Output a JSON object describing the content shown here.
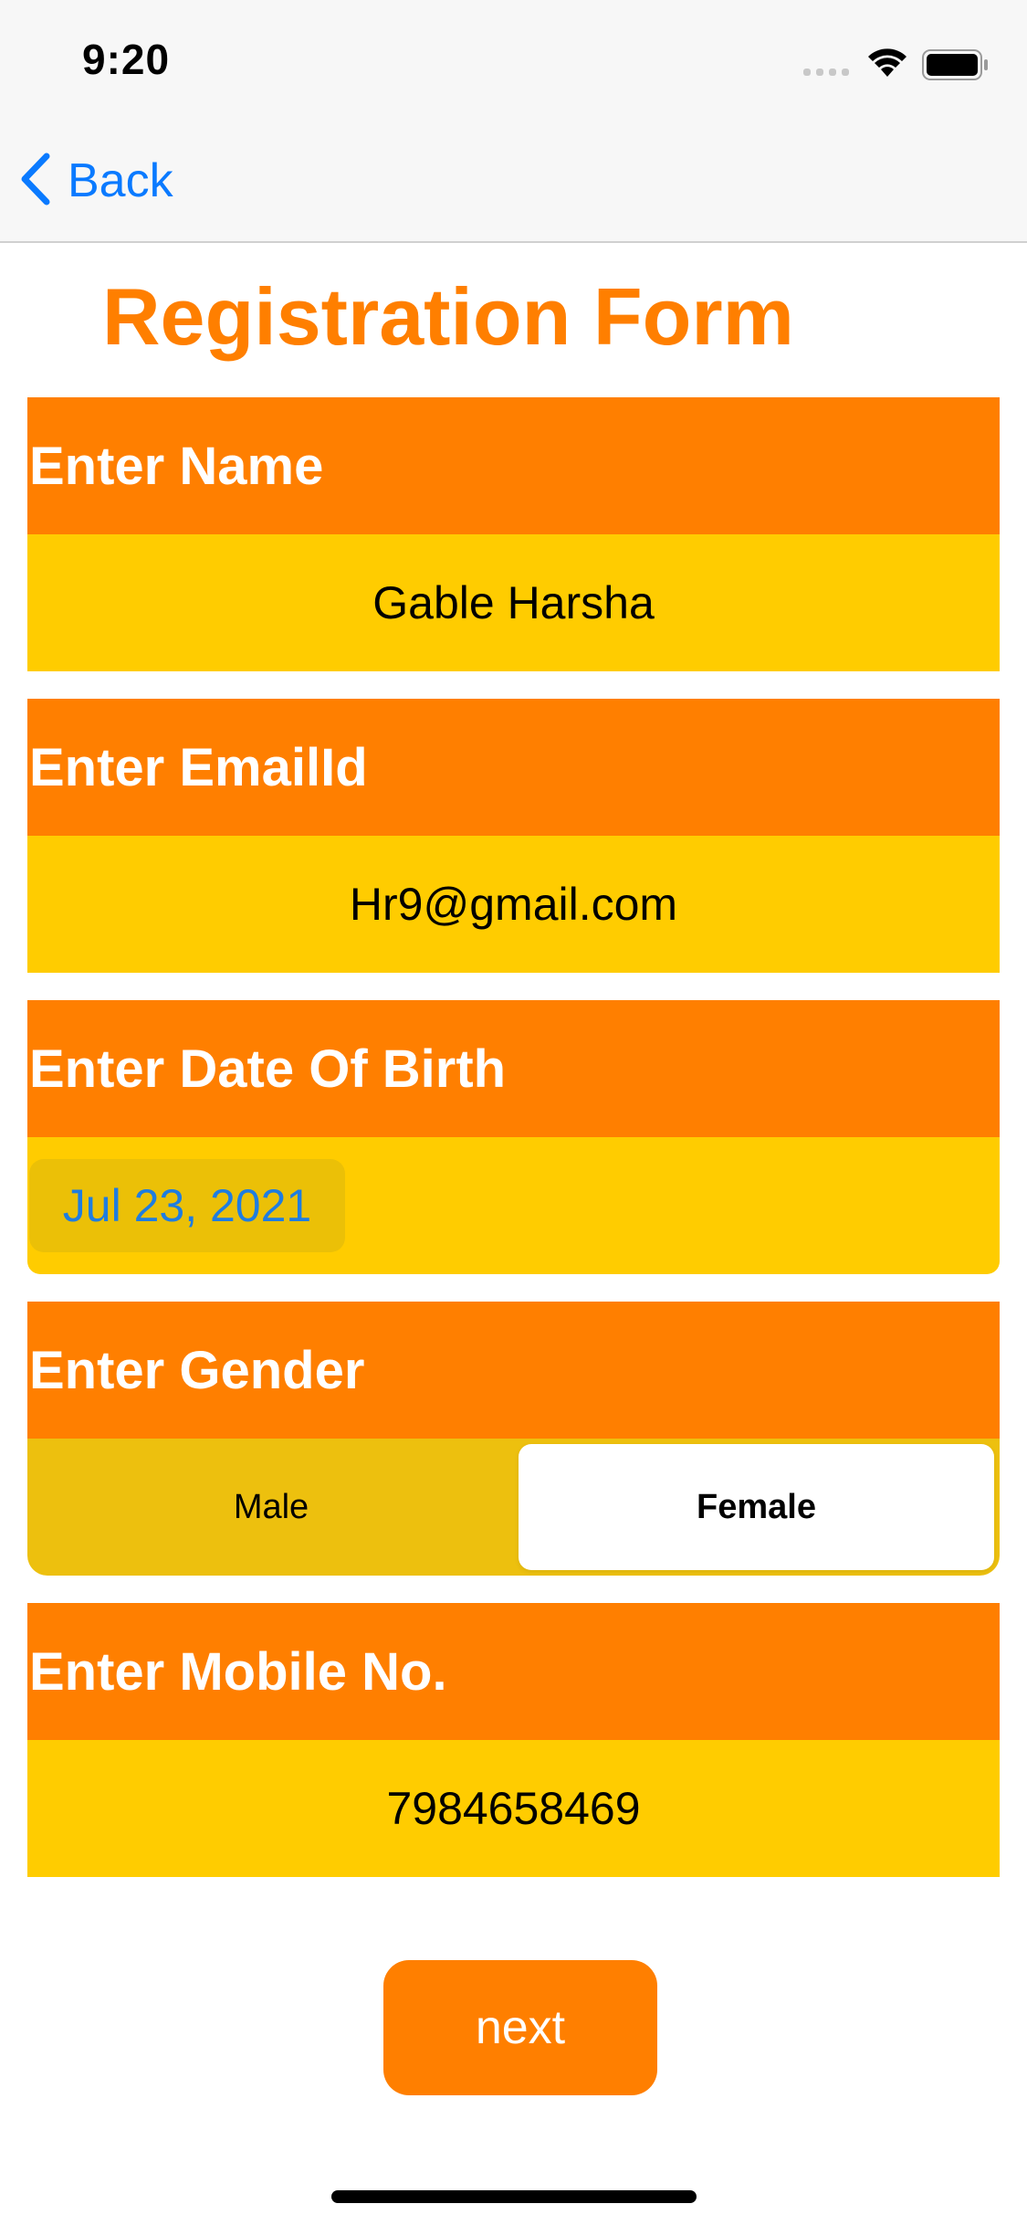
{
  "status_bar": {
    "time": "9:20",
    "icons": [
      "signal-icon",
      "wifi-icon",
      "battery-icon"
    ]
  },
  "nav": {
    "back_label": "Back",
    "back_icon": "chevron-left-icon"
  },
  "form": {
    "title": "Registration Form",
    "name": {
      "label": "Enter Name",
      "value": "Gable Harsha"
    },
    "email": {
      "label": "Enter EmailId",
      "value": "Hr9@gmail.com"
    },
    "dob": {
      "label": "Enter Date Of Birth",
      "value": "Jul 23, 2021"
    },
    "gender": {
      "label": "Enter Gender",
      "options": [
        "Male",
        "Female"
      ],
      "selected": "Female"
    },
    "mobile": {
      "label": "Enter Mobile No.",
      "value": "7984658469"
    },
    "next_label": "next"
  },
  "colors": {
    "accent_orange": "#ff7f00",
    "field_yellow": "#ffcc00",
    "link_blue": "#0a7aff"
  }
}
